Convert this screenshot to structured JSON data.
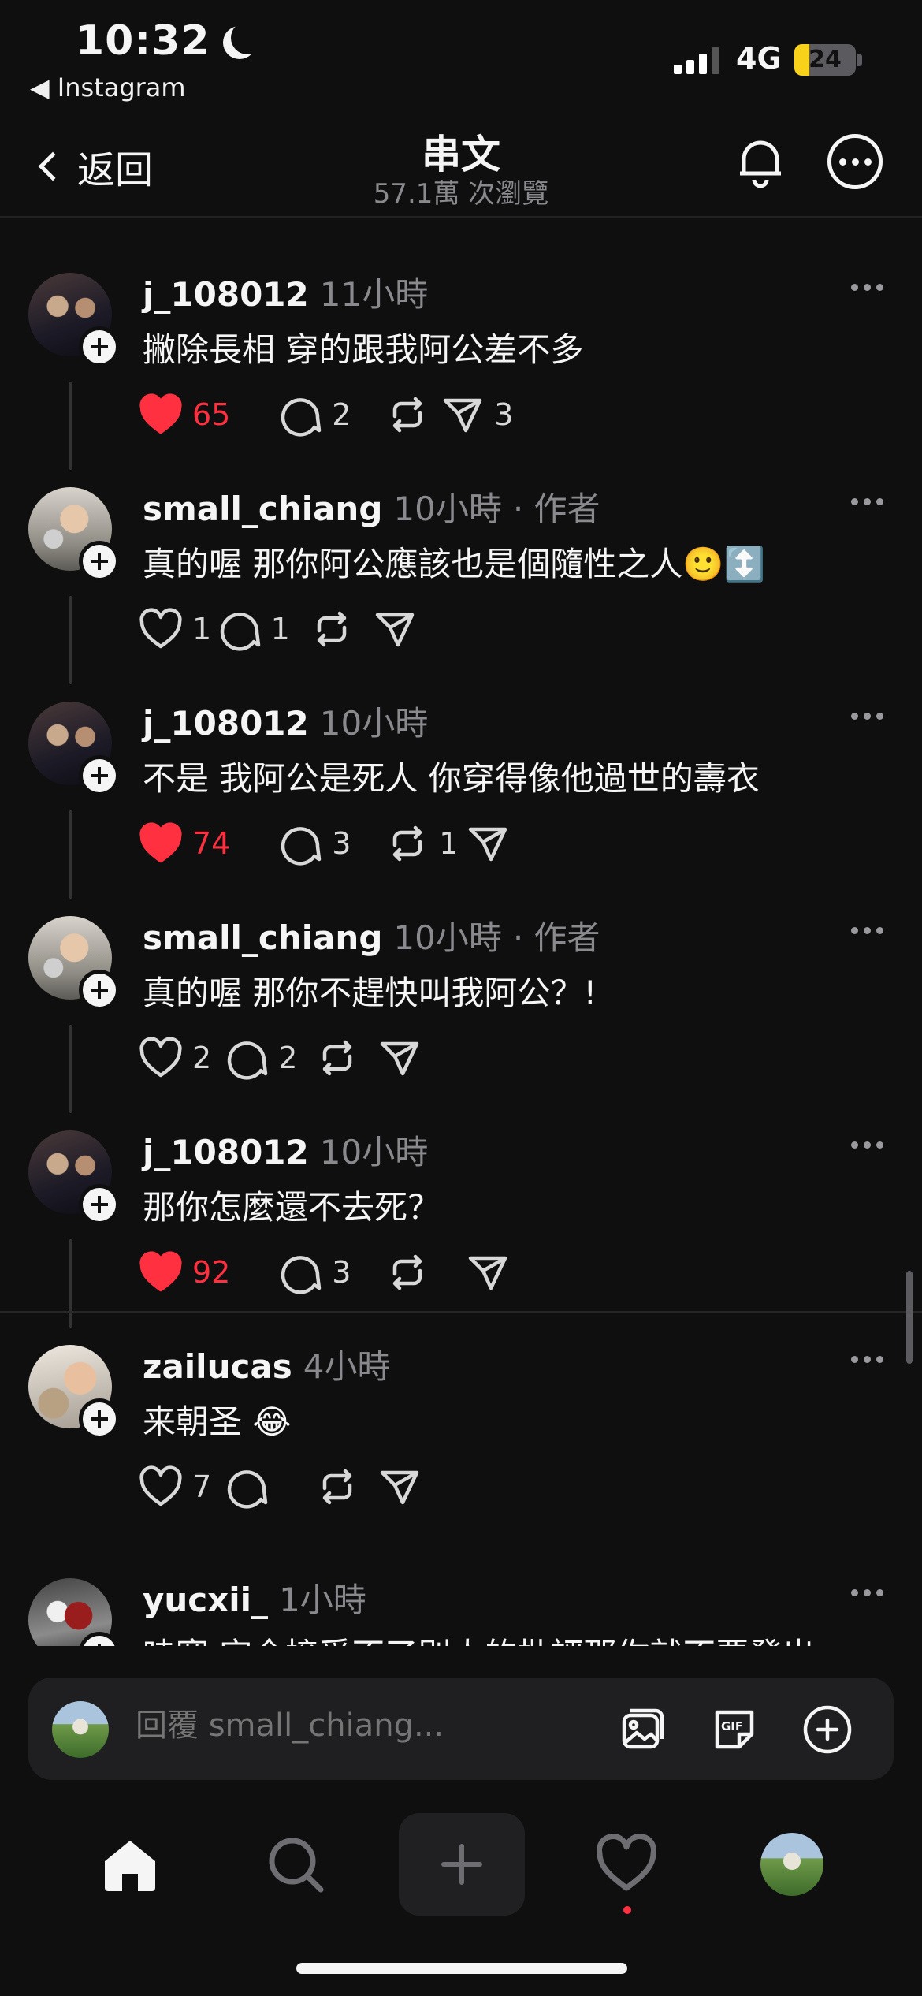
{
  "status_bar": {
    "time": "10:32",
    "back_app": "◀ Instagram",
    "network": "4G",
    "battery": "24"
  },
  "header": {
    "back_label": "返回",
    "title": "串文",
    "subtitle": "57.1萬 次瀏覽"
  },
  "comments": [
    {
      "user": "j_108012",
      "time": "11小時",
      "author_tag": "",
      "text": "撇除長相 穿的跟我阿公差不多",
      "likes": "65",
      "liked": true,
      "replies": "2",
      "reposts": "",
      "shares": "3"
    },
    {
      "user": "small_chiang",
      "time": "10小時",
      "author_tag": "· 作者",
      "text": "真的喔 那你阿公應該也是個隨性之人🙂↕️",
      "likes": "1",
      "liked": false,
      "replies": "1",
      "reposts": "",
      "shares": ""
    },
    {
      "user": "j_108012",
      "time": "10小時",
      "author_tag": "",
      "text": "不是 我阿公是死人 你穿得像他過世的壽衣",
      "likes": "74",
      "liked": true,
      "replies": "3",
      "reposts": "1",
      "shares": ""
    },
    {
      "user": "small_chiang",
      "time": "10小時",
      "author_tag": "· 作者",
      "text": "真的喔  那你不趕快叫我阿公？!",
      "likes": "2",
      "liked": false,
      "replies": "2",
      "reposts": "",
      "shares": ""
    },
    {
      "user": "j_108012",
      "time": "10小時",
      "author_tag": "",
      "text": "那你怎麼還不去死？",
      "likes": "92",
      "liked": true,
      "replies": "3",
      "reposts": "",
      "shares": ""
    },
    {
      "user": "zailucas",
      "time": "4小時",
      "author_tag": "",
      "text": "来朝圣 😂",
      "likes": "7",
      "liked": false,
      "replies": "",
      "reposts": "",
      "shares": ""
    },
    {
      "user": "yucxii_",
      "time": "1小時",
      "author_tag": "",
      "text": "哇塞 完全接受不了別人的批評那你就不要發出",
      "likes": "",
      "liked": false,
      "replies": "",
      "reposts": "",
      "shares": ""
    }
  ],
  "reply_bar": {
    "placeholder": "回覆 small_chiang..."
  },
  "colors": {
    "background": "#0f0f10",
    "like_red": "#ff3040",
    "muted": "#8a8a8e"
  },
  "icons": [
    "home-icon",
    "search-icon",
    "create-icon",
    "activity-heart-icon",
    "profile-icon",
    "bell-icon",
    "more-icon",
    "image-icon",
    "gif-icon",
    "add-icon"
  ]
}
